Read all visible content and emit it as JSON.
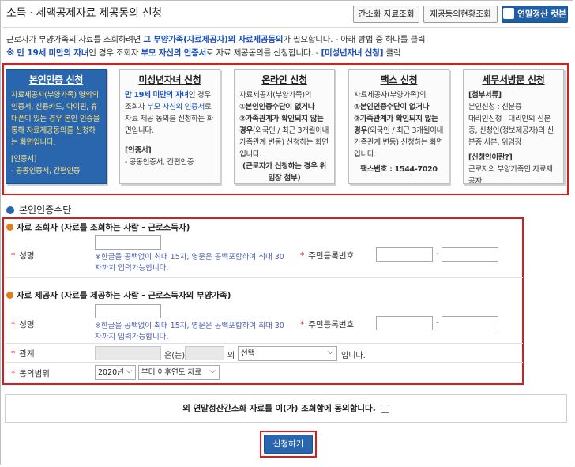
{
  "header": {
    "title": "소득 · 세액공제자료 제공동의 신청",
    "btn_simple": "간소화 자료조회",
    "btn_status": "제공동의현황조회",
    "btn_shortcut": "연말정산 컷본"
  },
  "intro": {
    "line1_a": "근로자가 부양가족의 자료를 조회하려면 ",
    "line1_b": "그 부양가족(자료제공자)의 자료제공동의",
    "line1_c": "가 필요합니다. - 아래 방법 중 하나를 클릭",
    "line2_a": "※ 만 19세 미만의 자녀",
    "line2_b": "인 경우 조회자 ",
    "line2_c": "부모 자신의 인증서",
    "line2_d": "로 자료 제공동의를 신청합니다. - ",
    "line2_e": "[미성년자녀 신청]",
    "line2_f": " 클릭"
  },
  "cards": [
    {
      "title": "본인인증 신청",
      "l1": "자료제공자(부양가족) 명의의 인증서, 신용카드, 아이핀, 휴대폰이 있는 경우 본인 인증을 통해 자료제공동의를 신청하는 화면입니다.",
      "l2": "[인증서]",
      "l3": "- 공동인증서, 간편인증"
    },
    {
      "title": "미성년자녀 신청",
      "l1a": "만 19세 미만의 자녀",
      "l1b": "인 경우 조회자 ",
      "l1c": "부모 자신의 인증서",
      "l1d": "로 자료 제공 동의를 신청하는 화면입니다.",
      "l2": "[인증서]",
      "l3": "- 공동인증서, 간편인증"
    },
    {
      "title": "온라인 신청",
      "l1": "자료제공자(부양가족)의",
      "l2": "①본인인증수단이 없거나",
      "l3": "②가족관계가 확인되지 않는 경우",
      "l3b": "(외국인 / 최근 3개월이내 가족관계 변동)",
      "l4": " 신청하는 화면입니다.",
      "l5": "(근로자가 신청하는 경우 위임장 첨부)"
    },
    {
      "title": "팩스 신청",
      "l1": "자료제공자(부양가족)의",
      "l2": "①본인인증수단이 없거나",
      "l3": "②가족관계가 확인되지 않는 경우",
      "l3b": "(외국인 / 최근 3개월이내 가족관계 변동)",
      "l4": " 신청하는 화면입니다.",
      "l5": "팩스번호 : 1544-7020"
    },
    {
      "title": "세무서방문 신청",
      "l1": "[첨부서류]",
      "l2": "본인신청 : 신분증",
      "l3": "대리인신청 : 대리인의 신분증, 신청인(정보제공자)의 신분증 사본, 위임장",
      "l4": "[신청인이란?]",
      "l5": "근로자의 부양가족인 자료제공자"
    }
  ],
  "form": {
    "section_title": "본인인증수단",
    "viewer_title": "자료 조회자 (자료를 조회하는 사람 - 근로소득자)",
    "provider_title": "자료 제공자 (자료를 제공하는 사람 - 근로소득자의 부양가족)",
    "name_label": "성명",
    "rrn_label": "주민등록번호",
    "name_note": "※한글을 공백없이 최대 15자, 영문은 공백포함하여 최대 30자까지 입력가능합니다.",
    "relation_label": "관계",
    "relation_mid": "은(는)",
    "relation_of": "의",
    "relation_select": "선택",
    "relation_end": "입니다.",
    "range_label": "동의범위",
    "range_year": "2020년",
    "range_option": "부터 이후연도 자료",
    "required_mark": "*"
  },
  "consent": {
    "text": "의 연말정산간소화 자료를 이(가) 조회함에 동의합니다."
  },
  "submit": {
    "label": "신청하기"
  },
  "colors": {
    "accent": "#2a66ad",
    "highlight": "#e0191c",
    "link": "#1a4fbf"
  }
}
